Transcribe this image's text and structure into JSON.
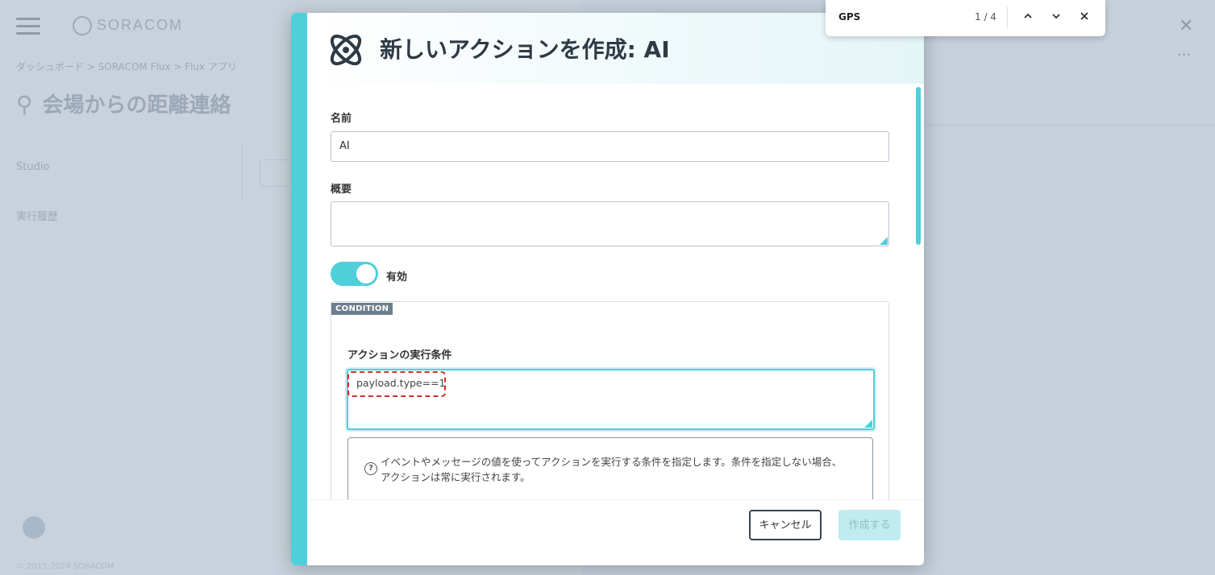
{
  "background": {
    "logo_text": "SORACOM",
    "breadcrumb": "ダッシュボード  >  SORACOM Flux  >  Flux アプリ",
    "page_title": "会場からの距離連絡",
    "page_subtitle": "",
    "nav_items": [
      "Studio",
      "実行履歴"
    ],
    "copyright": "© 2015-2024 SORACOM"
  },
  "modal": {
    "title": "新しいアクションを作成: AI",
    "name_label": "名前",
    "name_value": "AI",
    "description_label": "概要",
    "description_value": "",
    "toggle_label": "有効",
    "toggle_on": true,
    "condition_tag": "CONDITION",
    "condition_label": "アクションの実行条件",
    "condition_value": "payload.type==1",
    "help_text": "イベントやメッセージの値を使ってアクションを実行する条件を指定します。条件を指定しない場合、アクションは常に実行されます。",
    "cancel_label": "キャンセル",
    "create_label": "作成する"
  },
  "findbar": {
    "query": "GPS",
    "count": "1 / 4"
  },
  "colors": {
    "accent": "#4fcfd9",
    "highlight": "#d42b2b"
  }
}
